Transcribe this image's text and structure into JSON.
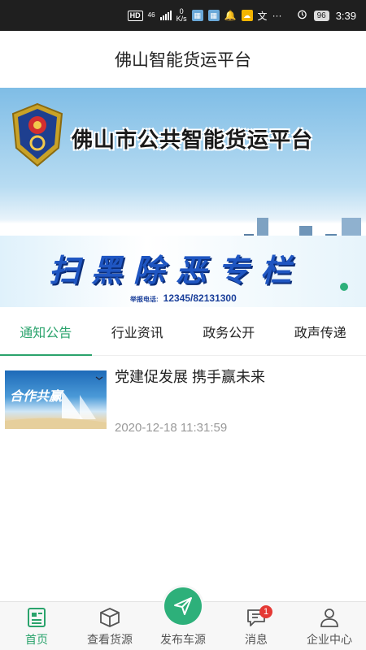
{
  "status_bar": {
    "hd": "HD",
    "network": "46",
    "speed_value": "0",
    "speed_unit": "K/s",
    "more": "···",
    "battery": "96",
    "time": "3:39"
  },
  "header": {
    "title": "佛山智能货运平台"
  },
  "banner": {
    "title": "佛山市公共智能货运平台",
    "slogan": "扫黑除恶专栏",
    "hotline_label": "举报电话:",
    "hotline": "12345/82131300"
  },
  "tabs": [
    {
      "label": "通知公告",
      "active": true
    },
    {
      "label": "行业资讯",
      "active": false
    },
    {
      "label": "政务公开",
      "active": false
    },
    {
      "label": "政声传递",
      "active": false
    }
  ],
  "news": [
    {
      "title": "党建促发展 携手赢未来",
      "time": "2020-12-18 11:31:59",
      "thumb_text": "合作共赢"
    }
  ],
  "bottom_nav": [
    {
      "label": "首页",
      "icon": "home-doc-icon",
      "active": true
    },
    {
      "label": "查看货源",
      "icon": "box-icon",
      "active": false
    },
    {
      "label": "发布车源",
      "icon": "send-plane-icon",
      "active": false
    },
    {
      "label": "消息",
      "icon": "message-icon",
      "active": false,
      "badge": "1"
    },
    {
      "label": "企业中心",
      "icon": "user-icon",
      "active": false
    }
  ],
  "colors": {
    "accent": "#2aa36c",
    "badge": "#e53935"
  }
}
